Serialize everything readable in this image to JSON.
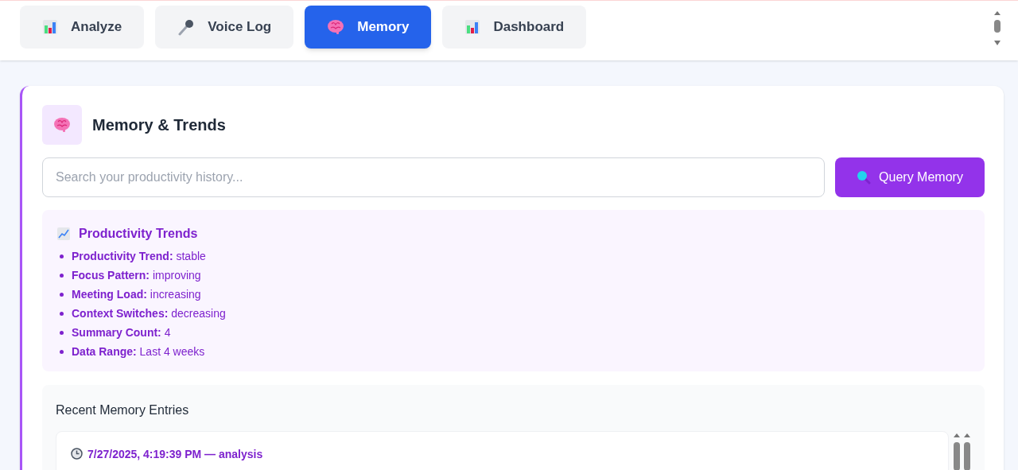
{
  "tabs": [
    {
      "label": "Analyze",
      "kind": "chart",
      "selected": false
    },
    {
      "label": "Voice Log",
      "kind": "mic",
      "selected": false
    },
    {
      "label": "Memory",
      "kind": "brain",
      "selected": true
    },
    {
      "label": "Dashboard",
      "kind": "chart",
      "selected": false
    }
  ],
  "panel": {
    "title": "Memory & Trends",
    "search": {
      "placeholder": "Search your productivity history..."
    },
    "query_button": "Query Memory",
    "trends": {
      "title": "Productivity Trends",
      "items": [
        "**Productivity Trend:** stable",
        "**Focus Pattern:** improving",
        "**Meeting Load:** increasing",
        "**Context Switches:** decreasing",
        "**Summary Count:** 4",
        "**Data Range:** Last 4 weeks"
      ]
    },
    "recent": {
      "title": "Recent Memory Entries",
      "entries": [
        {
          "header": "7/27/2025, 4:19:39 PM — analysis"
        }
      ]
    }
  }
}
